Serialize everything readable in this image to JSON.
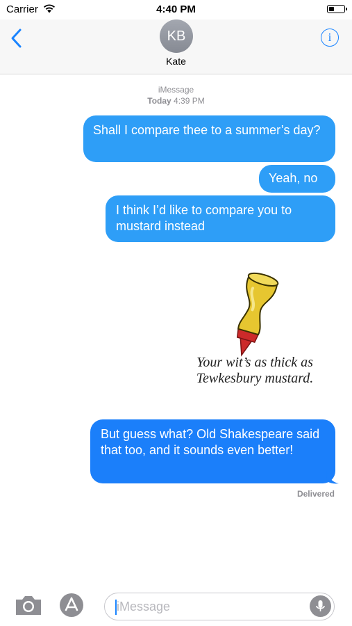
{
  "status_bar": {
    "carrier": "Carrier",
    "time": "4:40 PM",
    "battery_level": 0.35
  },
  "header": {
    "contact_initials": "KB",
    "contact_name": "Kate"
  },
  "thread": {
    "service_label": "iMessage",
    "timestamp_day": "Today",
    "timestamp_time": "4:39 PM",
    "messages": [
      {
        "text": "Shall I compare thee to a summer’s day?"
      },
      {
        "text": "Yeah, no"
      },
      {
        "text": "I think I’d like to compare you to mustard instead"
      },
      {
        "text": "But guess what? Old Shakespeare said that too, and it sounds even better!"
      }
    ],
    "sticker_caption_line1": "Your wit’s as thick as",
    "sticker_caption_line2": "Tewkesbury mustard.",
    "delivery_status": "Delivered"
  },
  "composer": {
    "placeholder": "iMessage"
  },
  "colors": {
    "bubble_blue": "#2e9ef7",
    "bubble_blue_dark": "#1b7ffa",
    "accent": "#1a84ff",
    "mustard": "#e6c630"
  }
}
